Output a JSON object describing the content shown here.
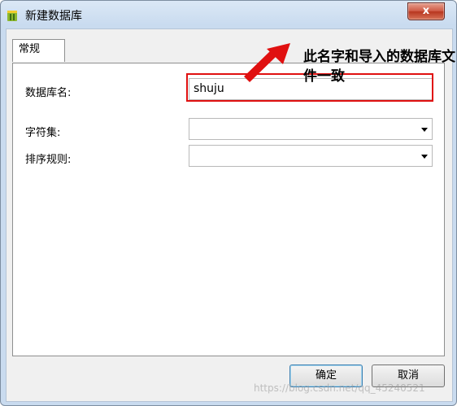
{
  "window": {
    "title": "新建数据库",
    "close_label": "x"
  },
  "tabs": [
    {
      "label": "常规"
    }
  ],
  "form": {
    "db_name_label": "数据库名:",
    "db_name_value": "shuju",
    "charset_label": "字符集:",
    "charset_value": "",
    "collation_label": "排序规则:",
    "collation_value": ""
  },
  "annotation": {
    "text": "此名字和导入的数据库文件一致"
  },
  "buttons": {
    "ok_label": "确定",
    "cancel_label": "取消"
  },
  "watermark": "https://blog.csdn.net/qq_45240521",
  "colors": {
    "highlight": "#e01010",
    "close_button": "#c7432d"
  },
  "icons": {
    "app": "database-icon",
    "close": "close-icon",
    "dropdown": "chevron-down-icon"
  }
}
